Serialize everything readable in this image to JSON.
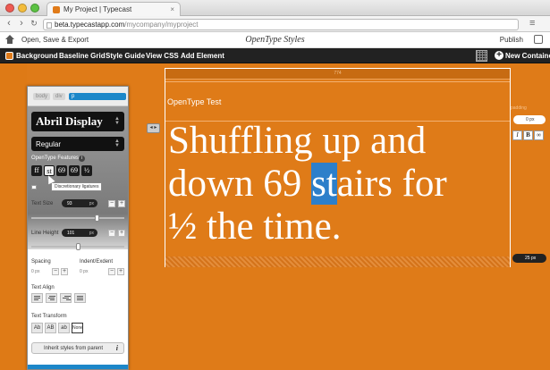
{
  "browser": {
    "tab_title": "My Project | Typecast",
    "tab_close": "×",
    "url_domain": "beta.typecastapp.com",
    "url_path": "/mycompany/myproject",
    "back": "‹",
    "forward": "›",
    "reload": "↻",
    "wrench": "≡"
  },
  "header": {
    "open_save": "Open, Save & Export",
    "title": "OpenType Styles",
    "publish": "Publish"
  },
  "toolbar": {
    "background": "Background",
    "baseline_grid": "Baseline Grid",
    "style_guide": "Style Guide",
    "view_css": "View CSS",
    "add_element": "Add Element",
    "new_container": "New Container",
    "plus": "+"
  },
  "sidebar": {
    "crumbs": [
      "body",
      "div",
      "p"
    ],
    "font": "Abril Display",
    "style": "Regular",
    "opentype_label": "OpenType Features",
    "info": "i",
    "ot_buttons": [
      "ff",
      "st",
      "69",
      "69",
      "½"
    ],
    "tooltip": "Discretionary ligatures",
    "text_size_label": "Text Size",
    "text_size_value": "93",
    "text_size_slider": 0.72,
    "line_height_label": "Line Height",
    "line_height_value": "101",
    "line_height_slider": 0.5,
    "unit": "px",
    "minus": "−",
    "plus": "+",
    "spacing_label": "Spacing",
    "indent_label": "Indent/Exdent",
    "spacing_value": "0",
    "indent_value": "0",
    "text_align_label": "Text Align",
    "text_transform_label": "Text Transform",
    "transform_buttons": [
      "Ab",
      "AB",
      "ab",
      "None"
    ],
    "inherit": "Inherit styles from parent",
    "inherit_icon": "i"
  },
  "container": {
    "ruler": "774",
    "title": "OpenType Test",
    "line1": "Shuffling up and",
    "line2_pre": "down 69 ",
    "line2_hl": "st",
    "line2_post": "airs for",
    "line3": "½ the time.",
    "handle": "◂ ▸"
  },
  "right": {
    "label": "padding",
    "top_value": "0",
    "icons": [
      "I",
      "B",
      "∞"
    ],
    "bottom_value": "25",
    "unit": "px"
  },
  "colors": {
    "canvas": "#df7b18",
    "accent": "#1c87c9",
    "highlight": "#2d7fca"
  }
}
